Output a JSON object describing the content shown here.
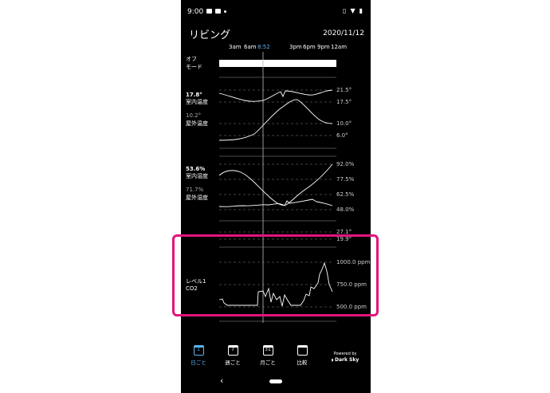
{
  "status": {
    "time": "9:00"
  },
  "header": {
    "title": "リビング",
    "date": "2020/11/12"
  },
  "time_ticks": {
    "t3am": "3am",
    "t6am": "6am",
    "now": "8:52",
    "t3pm": "3pm",
    "t6pm": "6pm",
    "t9pm": "9pm",
    "t12am": "12am"
  },
  "mode": {
    "line1": "オフ",
    "line2": "モード"
  },
  "temperature": {
    "indoor_value": "17.8°",
    "indoor_label": "室内温度",
    "outdoor_value": "10.2°",
    "outdoor_label": "屋外温度",
    "axis": [
      "21.5°",
      "17.5°",
      "10.0°",
      "6.0°"
    ]
  },
  "humidity": {
    "indoor_value": "53.6%",
    "indoor_label": "室内湿度",
    "outdoor_value": "71.7%",
    "outdoor_label": "屋外湿度",
    "axis": [
      "92.0%",
      "77.5%",
      "62.5%",
      "48.0%"
    ]
  },
  "partial_axis": [
    "27.1°",
    "19.9°"
  ],
  "co2": {
    "level_label": "レベル1",
    "gas_label": "CO2",
    "axis": [
      "1000.0 ppm",
      "750.0 ppm",
      "500.0 ppm"
    ]
  },
  "nav": {
    "day": "日ごと",
    "week": "週ごと",
    "month": "月ごと",
    "compare": "比較",
    "day_icon": "1",
    "week_icon": "7",
    "month_icon": "31"
  },
  "powered": {
    "line1": "Powered by",
    "line2": "Dark Sky"
  },
  "colors": {
    "accent": "#5ab4f0",
    "highlight": "#e4147b",
    "background": "#000000"
  }
}
